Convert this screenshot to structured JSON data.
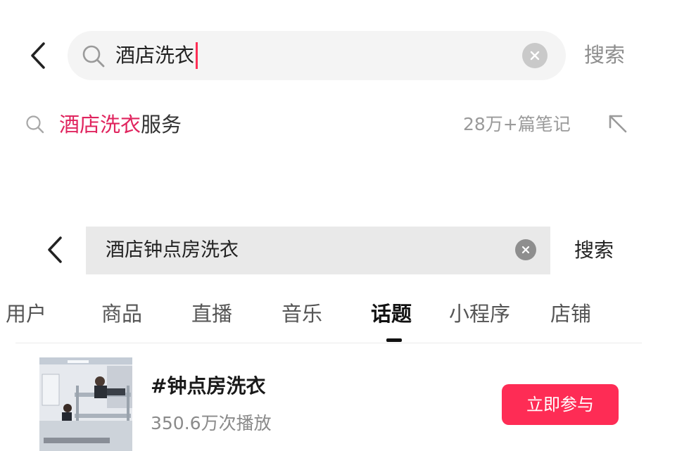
{
  "top_search": {
    "query": "酒店洗衣",
    "search_label": "搜索"
  },
  "suggestion": {
    "highlight": "酒店洗衣",
    "rest": "服务",
    "count": "28万+篇笔记"
  },
  "second_search": {
    "query": "酒店钟点房洗衣",
    "search_label": "搜索"
  },
  "tabs": [
    {
      "label": "用户"
    },
    {
      "label": "商品"
    },
    {
      "label": "直播"
    },
    {
      "label": "音乐"
    },
    {
      "label": "话题",
      "active": true
    },
    {
      "label": "小程序"
    },
    {
      "label": "店铺"
    }
  ],
  "topic": {
    "title": "#钟点房洗衣",
    "plays": "350.6万次播放",
    "join_label": "立即参与"
  },
  "colors": {
    "accent": "#fe2c55",
    "highlight_text": "#e0245e"
  }
}
